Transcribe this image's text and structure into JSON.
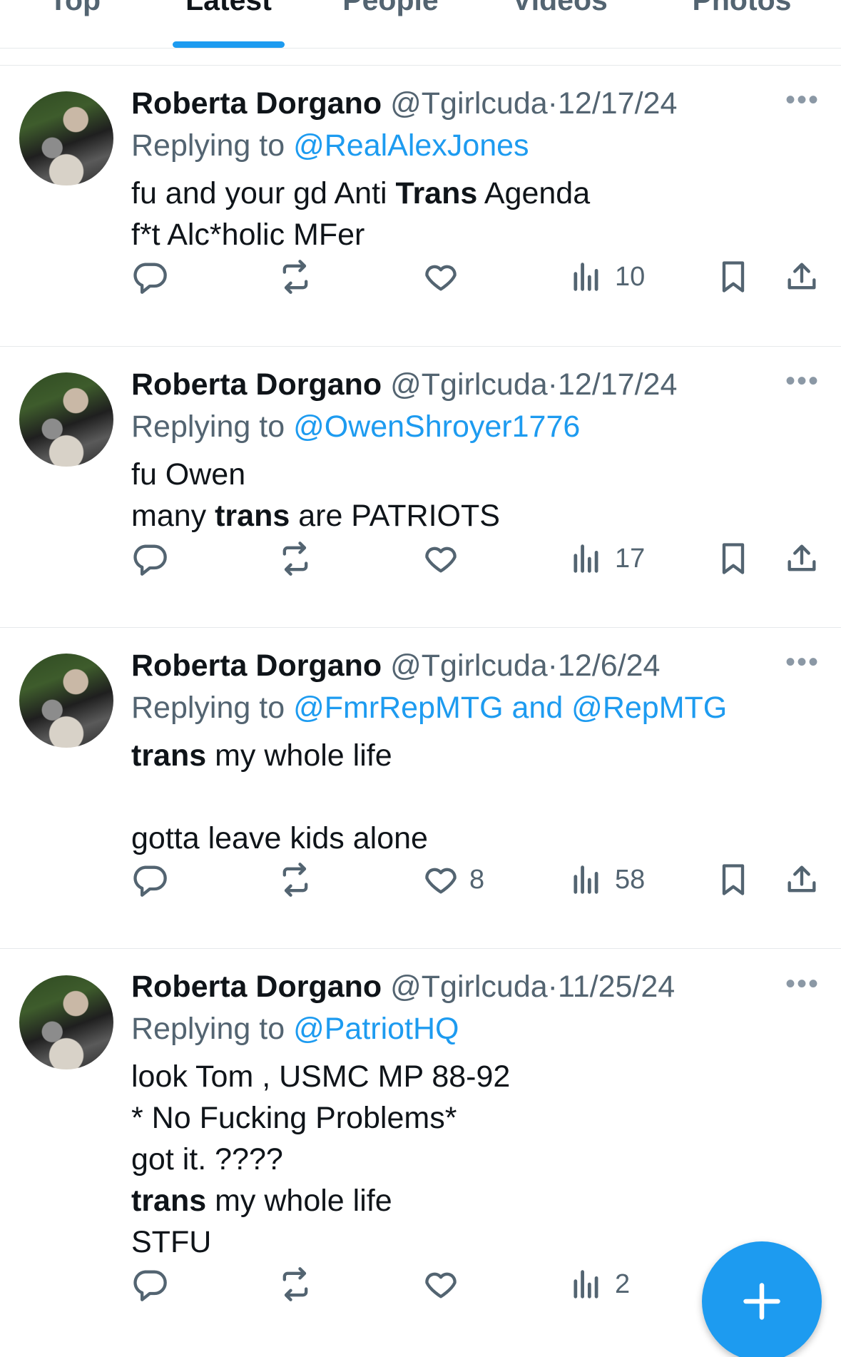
{
  "tabs": [
    "Top",
    "Latest",
    "People",
    "Videos",
    "Photos"
  ],
  "active_tab": "Latest",
  "tweets": [
    {
      "name": "Roberta Dorgano",
      "handle": "@Tgirlcuda",
      "date": "12/17/24",
      "replying_prefix": "Replying to ",
      "replying_to": "@RealAlexJones",
      "body": [
        {
          "parts": [
            {
              "t": "fu and your gd Anti ",
              "b": false
            },
            {
              "t": "Trans",
              "b": true
            },
            {
              "t": " Agenda",
              "b": false
            }
          ]
        },
        {
          "parts": [
            {
              "t": "f*t Alc*holic MFer",
              "b": false
            }
          ]
        }
      ],
      "likes": "",
      "views": "10",
      "more": "•••"
    },
    {
      "name": "Roberta Dorgano",
      "handle": "@Tgirlcuda",
      "date": "12/17/24",
      "replying_prefix": "Replying to ",
      "replying_to": "@OwenShroyer1776",
      "body": [
        {
          "parts": [
            {
              "t": "fu Owen",
              "b": false
            }
          ]
        },
        {
          "parts": [
            {
              "t": "many ",
              "b": false
            },
            {
              "t": "trans",
              "b": true
            },
            {
              "t": " are PATRIOTS",
              "b": false
            }
          ]
        }
      ],
      "likes": "",
      "views": "17",
      "more": "•••"
    },
    {
      "name": "Roberta Dorgano",
      "handle": "@Tgirlcuda",
      "date": "12/6/24",
      "replying_prefix": "Replying to ",
      "replying_to": "@FmrRepMTG and @RepMTG",
      "body": [
        {
          "parts": [
            {
              "t": "trans",
              "b": true
            },
            {
              "t": " my whole life",
              "b": false
            }
          ]
        },
        {
          "parts": [
            {
              "t": " ",
              "b": false
            }
          ]
        },
        {
          "parts": [
            {
              "t": "gotta leave kids alone",
              "b": false
            }
          ]
        }
      ],
      "likes": "8",
      "views": "58",
      "more": "•••"
    },
    {
      "name": "Roberta Dorgano",
      "handle": "@Tgirlcuda",
      "date": "11/25/24",
      "replying_prefix": "Replying to ",
      "replying_to": "@PatriotHQ",
      "body": [
        {
          "parts": [
            {
              "t": "look Tom , USMC MP 88-92",
              "b": false
            }
          ]
        },
        {
          "parts": [
            {
              "t": "* No Fucking Problems*",
              "b": false
            }
          ]
        },
        {
          "parts": [
            {
              "t": "got it. ????",
              "b": false
            }
          ]
        },
        {
          "parts": [
            {
              "t": "trans",
              "b": true
            },
            {
              "t": " my whole life",
              "b": false
            }
          ]
        },
        {
          "parts": [
            {
              "t": "STFU",
              "b": false
            }
          ]
        }
      ],
      "likes": "",
      "views": "2",
      "more": "•••"
    }
  ],
  "colors": {
    "accent": "#1d9bf0",
    "text": "#0f1419",
    "muted": "#536471",
    "divider": "#e6e9eb"
  },
  "icons": [
    "reply-icon",
    "retweet-icon",
    "like-icon",
    "views-icon",
    "bookmark-icon",
    "share-icon",
    "more-icon",
    "compose-plus-icon"
  ]
}
